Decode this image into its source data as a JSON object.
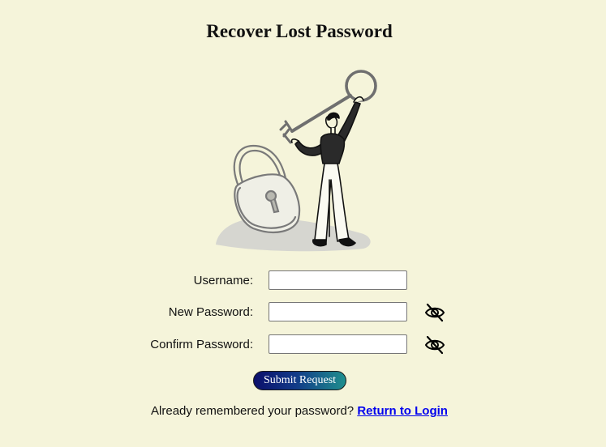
{
  "page": {
    "title": "Recover Lost Password"
  },
  "illustration": {
    "icon": "person-holding-key-with-padlock-illustration"
  },
  "form": {
    "username": {
      "label": "Username:",
      "value": "",
      "placeholder": ""
    },
    "new_password": {
      "label": "New Password:",
      "value": "",
      "placeholder": "",
      "toggle_icon": "eye-slash-icon"
    },
    "confirm_password": {
      "label": "Confirm Password:",
      "value": "",
      "placeholder": "",
      "toggle_icon": "eye-slash-icon"
    },
    "submit_label": "Submit Request"
  },
  "footer": {
    "prompt": "Already remembered your password?",
    "link_label": "Return to Login"
  },
  "colors": {
    "background": "#f5f4da",
    "link": "#0000ee",
    "button_gradient_start": "#0b0f6b",
    "button_gradient_end": "#1f8f8e"
  }
}
